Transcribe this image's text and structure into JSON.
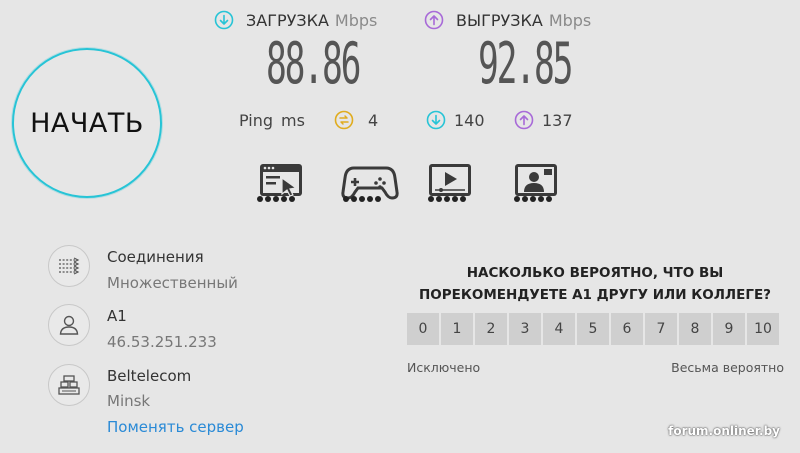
{
  "start_button": {
    "label": "НАЧАТЬ"
  },
  "download": {
    "label": "ЗАГРУЗКА",
    "unit": "Mbps",
    "value": "88.86",
    "color": "#27c4d6"
  },
  "upload": {
    "label": "ВЫГРУЗКА",
    "unit": "Mbps",
    "value": "92.85",
    "color": "#a86ad8"
  },
  "ping": {
    "label": "Ping",
    "unit": "ms",
    "value": "4",
    "download_latency": "140",
    "upload_latency": "137",
    "ping_color": "#e0ac1e"
  },
  "tests": [
    {
      "icon": "browsing-icon"
    },
    {
      "icon": "gaming-icon"
    },
    {
      "icon": "video-streaming-icon"
    },
    {
      "icon": "video-call-icon"
    }
  ],
  "connection": {
    "title": "Соединения",
    "value": "Множественный",
    "icon": "connections-icon"
  },
  "provider": {
    "name": "A1",
    "ip": "46.53.251.233",
    "icon": "user-icon"
  },
  "server": {
    "name": "Beltelecom",
    "city": "Minsk",
    "change_link": "Поменять сервер",
    "icon": "server-icon"
  },
  "survey": {
    "question": "НАСКОЛЬКО ВЕРОЯТНО, ЧТО ВЫ ПОРЕКОМЕНДУЕТЕ A1 ДРУГУ ИЛИ КОЛЛЕГЕ?",
    "scale": [
      "0",
      "1",
      "2",
      "3",
      "4",
      "5",
      "6",
      "7",
      "8",
      "9",
      "10"
    ],
    "low_label": "Исключено",
    "high_label": "Весьма вероятно"
  },
  "watermark": "forum.onliner.by"
}
